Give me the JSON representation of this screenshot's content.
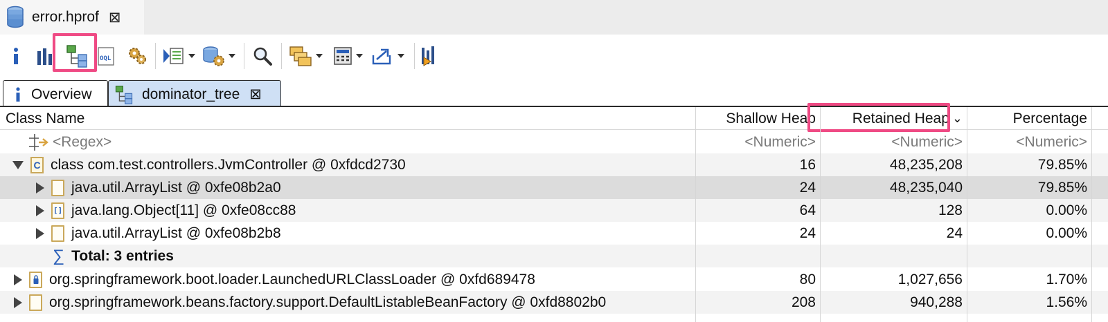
{
  "editor_tab": {
    "title": "error.hprof",
    "close_glyph": "⊠"
  },
  "toolbar": {
    "buttons": [
      "info-icon",
      "histogram-icon",
      "dominator-tree-icon",
      "oql-icon",
      "thread-settings-icon",
      "top-consumers-icon",
      "query-browser-icon",
      "search-icon",
      "group-result-icon",
      "calculate-icon",
      "export-icon",
      "fast-forward-icon"
    ],
    "highlight_color": "#ef4a84"
  },
  "view_tabs": {
    "overview": "Overview",
    "dominator": "dominator_tree",
    "close_glyph": "⊠",
    "active_color": "#cfe0f5"
  },
  "table": {
    "headers": {
      "class_name": "Class Name",
      "shallow_heap": "Shallow Heap",
      "retained_heap": "Retained Heap",
      "sort_glyph": "⌄",
      "percentage": "Percentage"
    },
    "filter": {
      "regex": "<Regex>",
      "shallow": "<Numeric>",
      "retained": "<Numeric>",
      "percentage": "<Numeric>"
    },
    "rows": [
      {
        "name": "class com.test.controllers.JvmController @ 0xfdcd2730",
        "shallow": "16",
        "retained": "48,235,208",
        "percentage": "79.85%"
      },
      {
        "name": "java.util.ArrayList @ 0xfe08b2a0",
        "shallow": "24",
        "retained": "48,235,040",
        "percentage": "79.85%"
      },
      {
        "name": "java.lang.Object[11] @ 0xfe08cc88",
        "shallow": "64",
        "retained": "128",
        "percentage": "0.00%"
      },
      {
        "name": "java.util.ArrayList @ 0xfe08b2b8",
        "shallow": "24",
        "retained": "24",
        "percentage": "0.00%"
      },
      {
        "name": "Total: 3 entries",
        "shallow": "",
        "retained": "",
        "percentage": ""
      },
      {
        "name": "org.springframework.boot.loader.LaunchedURLClassLoader @ 0xfd689478",
        "shallow": "80",
        "retained": "1,027,656",
        "percentage": "1.70%"
      },
      {
        "name": "org.springframework.beans.factory.support.DefaultListableBeanFactory @ 0xfd8802b0",
        "shallow": "208",
        "retained": "940,288",
        "percentage": "1.56%"
      }
    ],
    "array_icon_glyph": "[]",
    "class_icon_glyph": "C",
    "sum_glyph": "∑"
  }
}
